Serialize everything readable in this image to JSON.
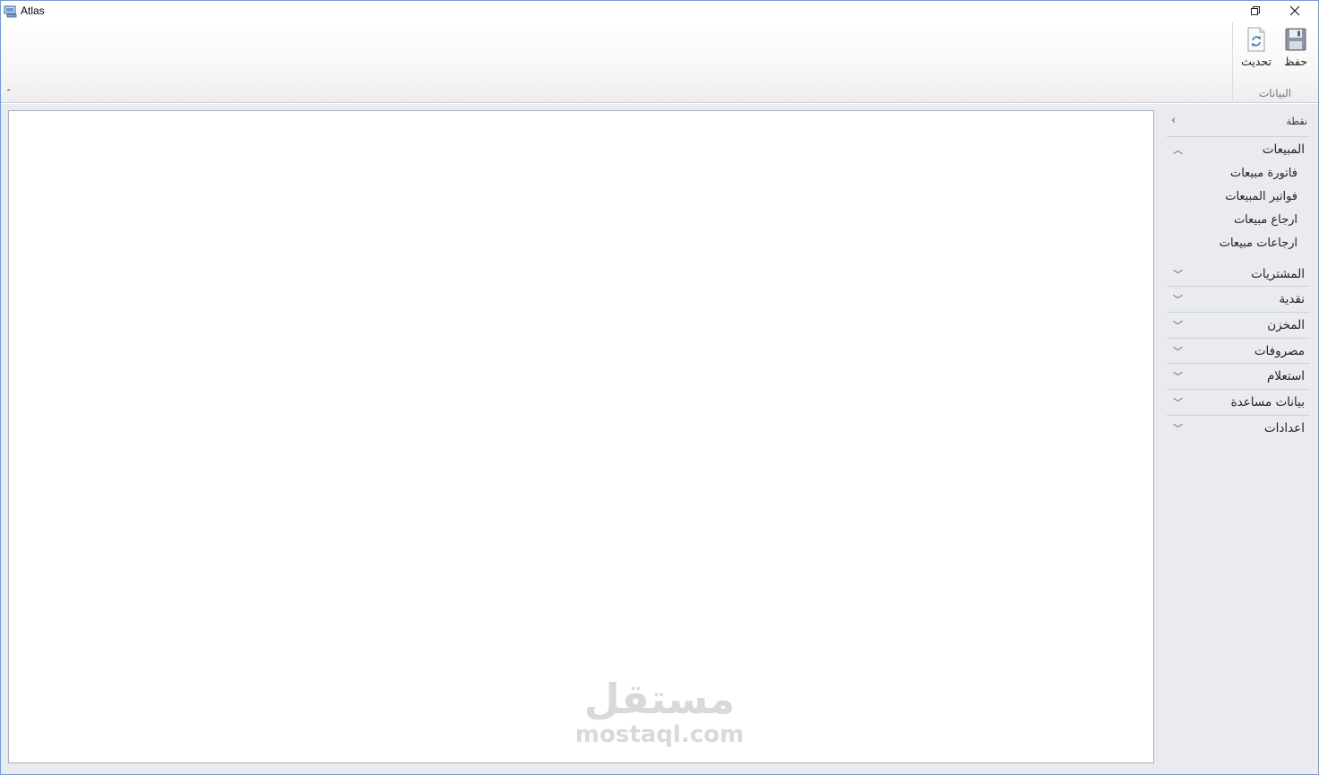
{
  "window": {
    "title": "Atlas"
  },
  "ribbon": {
    "group_label": "البيانات",
    "save_label": "حفظ",
    "refresh_label": "تحديث"
  },
  "nav": {
    "header": "نقطة",
    "groups": [
      {
        "label": "المبيعات",
        "expanded": true,
        "items": [
          "فاتورة مبيعات",
          "فواتير المبيعات",
          "ارجاع مبيعات",
          "ارجاعات مبيعات"
        ]
      },
      {
        "label": "المشتريات",
        "expanded": false
      },
      {
        "label": "نقدية",
        "expanded": false
      },
      {
        "label": "المخزن",
        "expanded": false
      },
      {
        "label": "مصروفات",
        "expanded": false
      },
      {
        "label": "استعلام",
        "expanded": false
      },
      {
        "label": "بيانات مساعدة",
        "expanded": false
      },
      {
        "label": "اعدادات",
        "expanded": false
      }
    ]
  },
  "watermark": {
    "arabic": "مستقل",
    "latin": "mostaql.com"
  },
  "colors": {
    "frame": "#7a9bd0",
    "panel": "#e9ebee",
    "separator": "#cdd2d8"
  }
}
